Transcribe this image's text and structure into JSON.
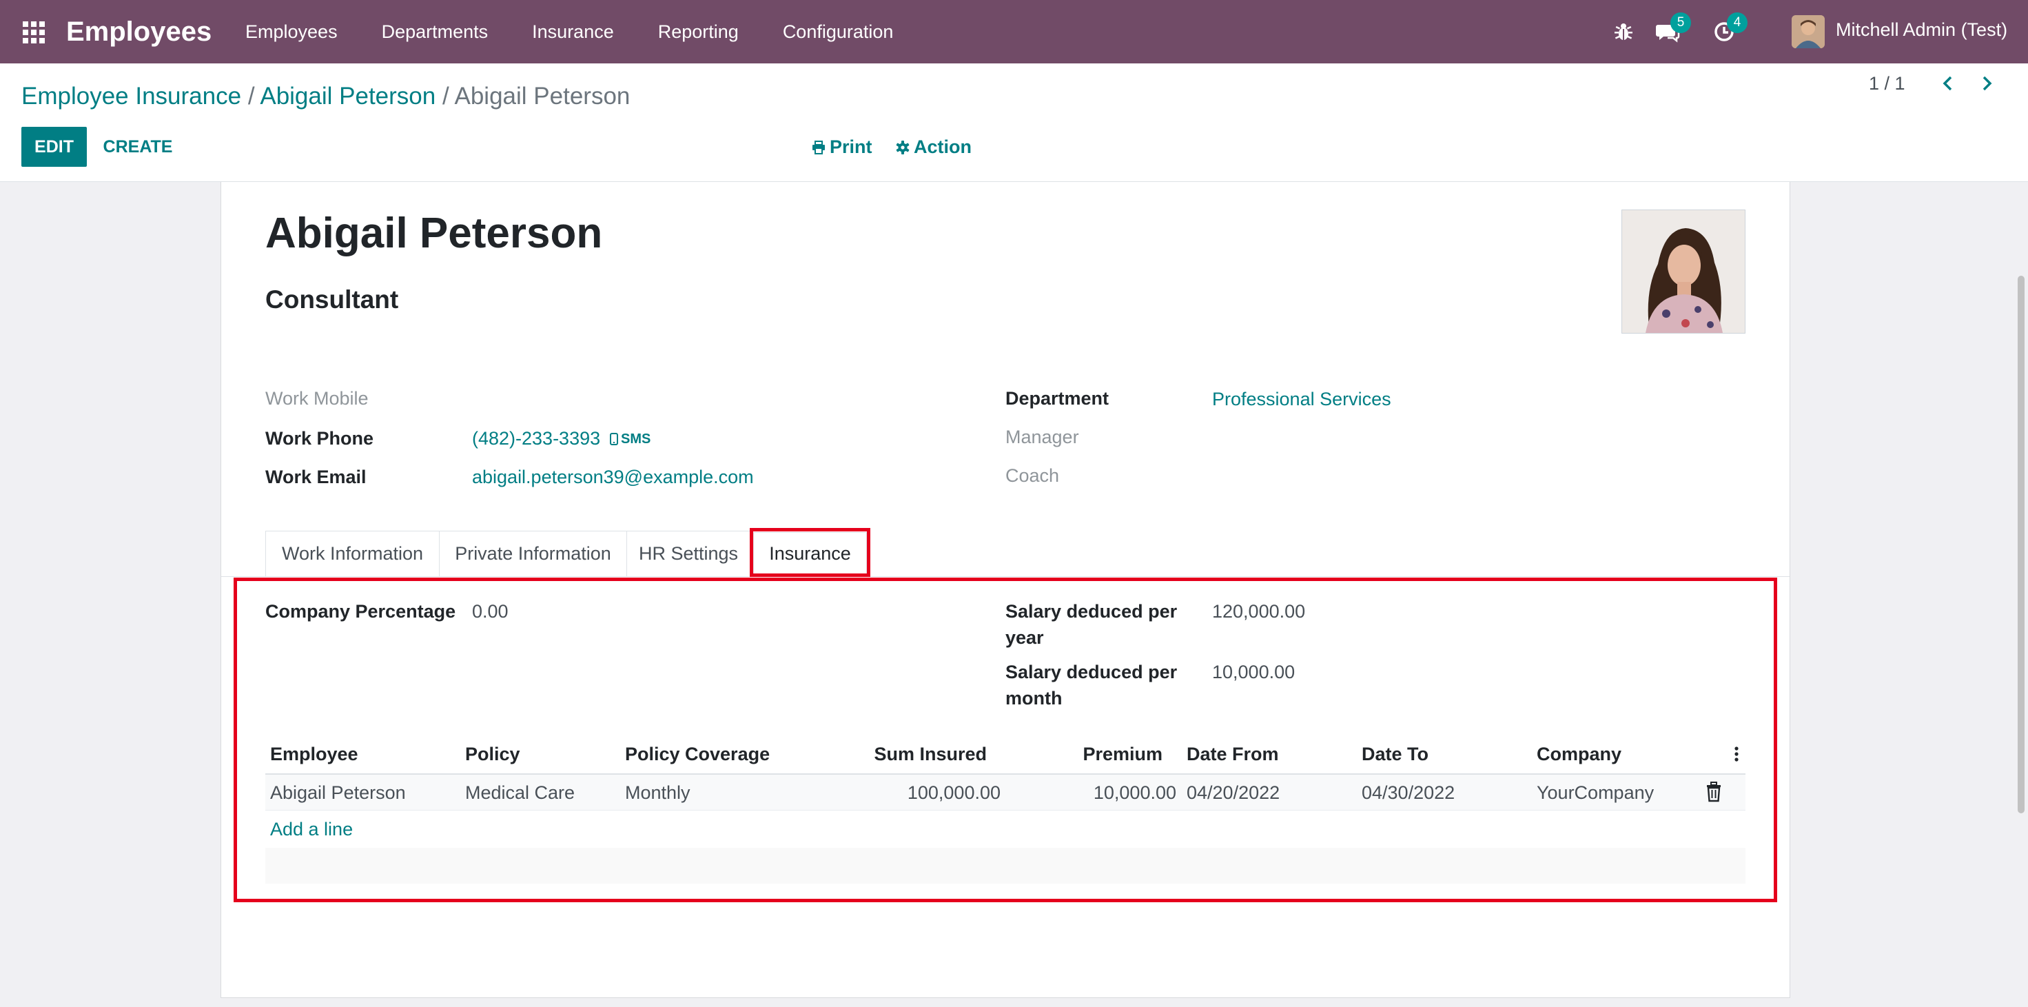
{
  "navbar": {
    "app_title": "Employees",
    "menu": [
      "Employees",
      "Departments",
      "Insurance",
      "Reporting",
      "Configuration"
    ],
    "messages_count": "5",
    "activities_count": "4",
    "user_name": "Mitchell Admin (Test)",
    "bg_color": "#714b67",
    "icons": [
      "apps-grid-icon",
      "bug-icon",
      "chat-icon",
      "clock-icon"
    ]
  },
  "breadcrumb": {
    "items": [
      "Employee Insurance",
      "Abigail Peterson"
    ],
    "separator": "/",
    "current": "Abigail Peterson"
  },
  "toolbar": {
    "edit_label": "EDIT",
    "create_label": "CREATE",
    "print_label": "Print",
    "action_label": "Action",
    "pager": "1 / 1",
    "accent_color": "#017e84"
  },
  "employee": {
    "name": "Abigail Peterson",
    "job_title": "Consultant",
    "fields_left": [
      {
        "label": "Work Mobile",
        "value": ""
      },
      {
        "label": "Work Phone",
        "value": "(482)-233-3393"
      },
      {
        "label": "Work Email",
        "value": "abigail.peterson39@example.com"
      }
    ],
    "sms_label": "SMS",
    "fields_right": [
      {
        "label": "Department",
        "value": "Professional Services"
      },
      {
        "label": "Manager",
        "value": ""
      },
      {
        "label": "Coach",
        "value": ""
      }
    ]
  },
  "tabs": [
    {
      "label": "Work Information",
      "active": false
    },
    {
      "label": "Private Information",
      "active": false
    },
    {
      "label": "HR Settings",
      "active": false
    },
    {
      "label": "Insurance",
      "active": true
    }
  ],
  "insurance": {
    "company_percentage_label": "Company Percentage",
    "company_percentage": "0.00",
    "salary_year_label_1": "Salary deduced per",
    "salary_year_label_2": "year",
    "salary_year": "120,000.00",
    "salary_month_label_1": "Salary deduced per",
    "salary_month_label_2": "month",
    "salary_month": "10,000.00",
    "columns": [
      "Employee",
      "Policy",
      "Policy Coverage",
      "Sum Insured",
      "Premium",
      "Date From",
      "Date To",
      "Company"
    ],
    "rows": [
      [
        "Abigail Peterson",
        "Medical Care",
        "Monthly",
        "100,000.00",
        "10,000.00",
        "04/20/2022",
        "04/30/2022",
        "YourCompany"
      ]
    ],
    "add_line_label": "Add a line"
  },
  "highlight_color": "#e5001c"
}
